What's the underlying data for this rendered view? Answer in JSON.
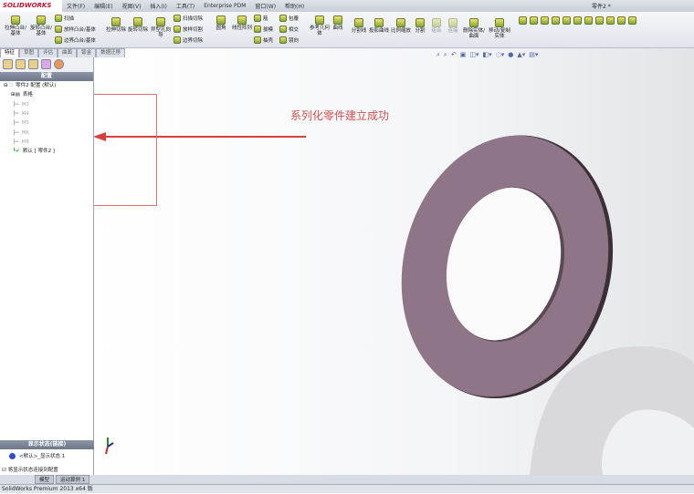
{
  "app": {
    "logo": "SOLIDWORKS",
    "title": "零件2 *"
  },
  "menu": [
    "文件(F)",
    "编辑(E)",
    "视图(V)",
    "插入(I)",
    "工具(T)",
    "Enterprise PDM",
    "窗口(W)",
    "帮助(H)"
  ],
  "ribbon": {
    "big": [
      "拉伸凸台/基体",
      "旋转凸台/基体",
      "拉伸切除",
      "旋转切除",
      "异型孔向导",
      "圆角",
      "线性阵列",
      "参考几何体",
      "曲线",
      "分割线",
      "投影曲线",
      "比例缩放",
      "分割",
      "组合",
      "连接",
      "删除实体/曲面",
      "移动/复制实体"
    ],
    "small": [
      "扫描",
      "放样凸台/基体",
      "边界凸台/基体",
      "扫描切除",
      "放样切割",
      "边界切除",
      "筋",
      "拔模",
      "抽壳",
      "包覆",
      "相交",
      "镜向"
    ]
  },
  "tabs": [
    "特征",
    "草图",
    "评估",
    "曲面",
    "钣金",
    "数据迁移"
  ],
  "panel": {
    "header": "配置",
    "root": "零件2 配置 (默认)",
    "table": "表格",
    "configs": [
      "M3",
      "M4",
      "M5",
      "M6",
      "M8"
    ],
    "active": "默认 [ 零件2 ]"
  },
  "display": {
    "header": "显示状态(链接)",
    "item": "<默认>_显示状态 1",
    "checkbox": "将显示状态连接到配置"
  },
  "annotation": "系列化零件建立成功",
  "bottom_tabs": [
    "模型",
    "运动算例 1"
  ],
  "status": "SolidWorks Premium 2013 x64 版",
  "colors": {
    "washer": "#8e7587",
    "arrow": "#d84040"
  }
}
